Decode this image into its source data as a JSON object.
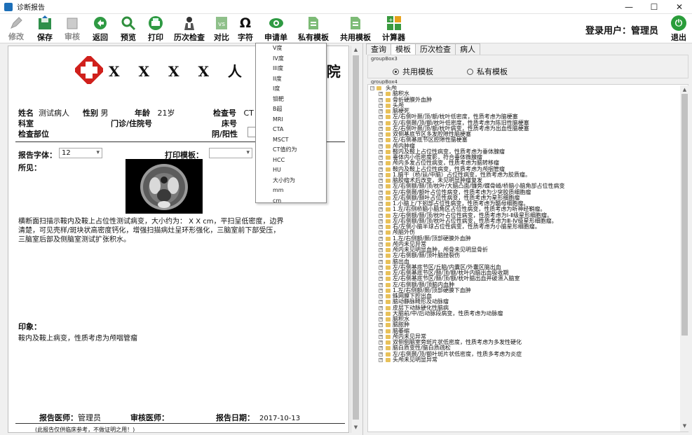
{
  "window": {
    "title": "诊断报告"
  },
  "toolbar": {
    "buttons": [
      {
        "label": "修改",
        "icon": "pencil-icon",
        "disabled": true
      },
      {
        "label": "保存",
        "icon": "save-icon",
        "disabled": false
      },
      {
        "label": "审核",
        "icon": "audit-icon",
        "disabled": true
      },
      {
        "label": "返回",
        "icon": "back-icon",
        "disabled": false
      },
      {
        "label": "预览",
        "icon": "magnifier-icon",
        "disabled": false
      },
      {
        "label": "打印",
        "icon": "printer-icon",
        "disabled": false
      },
      {
        "label": "历次检查",
        "icon": "person-icon",
        "disabled": false
      },
      {
        "label": "对比",
        "icon": "compare-icon",
        "disabled": false
      },
      {
        "label": "字符",
        "icon": "omega-icon",
        "disabled": false
      },
      {
        "label": "申请单",
        "icon": "eye-icon",
        "disabled": false
      },
      {
        "label": "私有模板",
        "icon": "template-icon",
        "disabled": false
      },
      {
        "label": "共用模板",
        "icon": "template-icon",
        "disabled": false
      },
      {
        "label": "计算器",
        "icon": "calculator-icon",
        "disabled": false
      }
    ],
    "user_label": "登录用户：",
    "user_name": "管理员",
    "exit_label": "退出"
  },
  "report": {
    "hospital_name": "X X X X 人 民 医 院",
    "fields": {
      "name_label": "姓名",
      "name_value": "测试病人",
      "sex_label": "性别",
      "sex_value": "男",
      "age_label": "年龄",
      "age_value": "21岁",
      "exam_no_label": "检查号",
      "exam_no_value": "CT",
      "dept_label": "科室",
      "outpatient_label": "门诊/住院号",
      "bed_label": "床号",
      "exam_site_label": "检查部位",
      "pos_neg_label": "阴/阳性"
    },
    "font_label": "报告字体：",
    "font_value": "12",
    "print_template_label": "打印模板：",
    "findings_label": "所见：",
    "findings_text": "横断面扫描示鞍内及鞍上占位性测试病变，大小约为：  X  X cm，平扫呈低密度，边界清楚，可见壳样/斑块状高密度钙化，增强扫描病灶呈环形强化，三脑室前下部受压，三脑室后部及侧脑室测试扩张积水。",
    "impression_label": "印象：",
    "impression_text": "鞍内及鞍上病变，性质考虑为颅咽管瘤",
    "doctor_label": "报告医师：",
    "doctor_value": "管理员",
    "reviewer_label": "审核医师：",
    "date_label": "报告日期：",
    "date_value": "2017-10-13",
    "footnote": "(此报告仅供临床参考，不做证明之用！)"
  },
  "dropdown": {
    "options": [
      "V度",
      "IV度",
      "III度",
      "II度",
      "I度",
      "钼靶",
      "B超",
      "MRI",
      "CTA",
      "MSCT",
      "CT值约为",
      "HCC",
      "HU",
      "大小约为",
      "mm",
      "cm"
    ]
  },
  "right": {
    "tabs": [
      "查询",
      "模板",
      "历次检查",
      "病人"
    ],
    "active_tab": 1,
    "groupbox3_title": "groupBox3",
    "groupbox4_title": "groupBox4",
    "radio_shared": "共用模板",
    "radio_private": "私有模板",
    "tree_root": "头颅",
    "tree_items": [
      "脑积水",
      "骨折硬膜外血肿",
      "头颅",
      "脑梗死",
      "左/右侧叶颞/顶/额/枕叶低密度，性质考虑为脑梗塞",
      "左/右侧颞/顶/额/枕叶低密度，性质考虑为陈旧性脑梗塞",
      "左/右侧叶颞/顶/额/枕叶病变，性质考虑为出血性脑梗塞",
      "双侧基底节区多发腔隙性脑梗塞",
      "左/右侧基底节区腔隙性脑梗塞",
      "颅内肿瘤",
      "鞍内及鞍上占位性病变，性质考虑为垂体腺瘤",
      "垂体内小低密度影，符合垂体微腺瘤",
      "颅内多发占位性病变，性质考虑为脑转移瘤",
      "鞍内及鞍上占位性病变，性质考虑为颅咽管瘤",
      "1.脑干（桥/延/中脑）占位性病变，性质考虑为胶质瘤。",
      "脑胶瘤术后改变，未见明显肿瘤复发",
      "左/右侧额/颞/顶/枕叶/大脑凸面/镰旁/蝶骨嵴/桥脑小脑角部占位性病变",
      "左/右侧颞/额叶占位性病变，性质考虑为少突胶质细胞瘤",
      "左/右侧额/颞叶占位性病变，性质考虑为星形细胞瘤",
      "1.小脑上/下蚓部占位性病变，性质考虑为髓母细胞瘤。",
      "1.左/右侧桥脑小脑角区占位性病变，性质考虑为听神经鞘瘤。",
      "左/右侧额/颞/顶/枕叶占位性病变，性质考虑为Ⅰ-Ⅱ级星形细胞瘤。",
      "左/右侧额/颞/顶/枕叶占位性病变，性质考虑为Ⅲ-Ⅳ级星形细胞瘤。",
      "右/左侧小脑半球占位性病变，性质考虑为小脑星形细胞瘤。",
      "颅脑外伤",
      "1.左/右侧额/颞/顶部硬膜外血肿",
      "颅内未见异常",
      "颅内未见明显血肿，颅骨未见明显骨折",
      "左/右侧额/颞/顶叶脑挫裂伤",
      "脑出血",
      "左/右侧基底节区/丘脑/内囊区/外囊区脑出血",
      "左/右侧基底节区/颞/顶/额/枕叶内脑出血吸收期",
      "左/右侧基底节区/颞/顶/额/枕叶脑出血并破溃入脑室",
      "左/右侧额/颞/顶脑内血肿",
      "1.左/右侧额/颞/顶部硬膜下血肿",
      "蛛网膜下腔出血",
      "脑动静脉畸形及动脉瘤",
      "皮层下动脉硬化性脑病",
      "大脑前/中/后动脉段病变，性质考虑为动脉瘤",
      "脑积水",
      "脑脓肿",
      "脑萎缩",
      "颅内未见异常",
      "双侧侧脑室旁斑片状低密度，性质考虑为多发性硬化",
      "脑白质变性/脑白质疏松",
      "左/右侧颞/顶/额叶斑片状低密度，性质多考虑为炎症",
      "头颅未见明显异常"
    ]
  }
}
